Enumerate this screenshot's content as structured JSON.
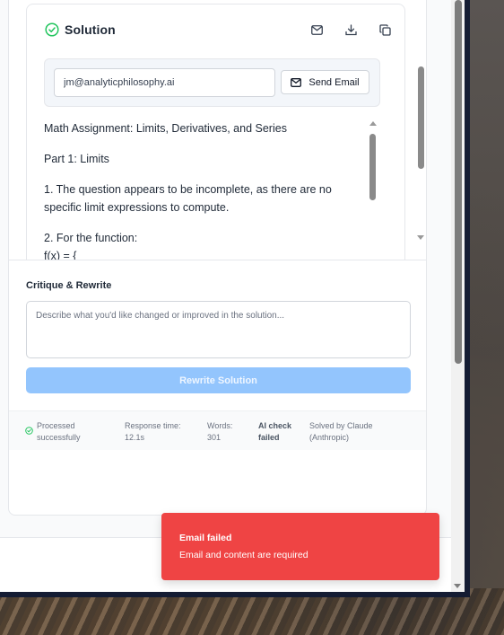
{
  "solution": {
    "title": "Solution",
    "actions": [
      "email-icon",
      "download-icon",
      "copy-icon"
    ],
    "email": {
      "value": "jm@analyticphilosophy.ai",
      "send_label": "Send Email"
    },
    "content": [
      "Math Assignment: Limits, Derivatives, and Series",
      "Part 1: Limits",
      "1. The question appears to be incomplete, as there are no specific limit expressions to compute.",
      "2. For the function:",
      "f(x) = {"
    ]
  },
  "critique": {
    "label": "Critique & Rewrite",
    "placeholder": "Describe what you'd like changed or improved in the solution...",
    "button_label": "Rewrite Solution"
  },
  "status": {
    "processed": "Processed successfully",
    "response_label": "Response time:",
    "response_value": "12.1s",
    "words_label": "Words:",
    "words_value": "301",
    "ai_check_label": "AI check",
    "ai_check_value": "failed",
    "solved_label": "Solved by Claude",
    "solved_value": "(Anthropic)"
  },
  "toast": {
    "title": "Email failed",
    "message": "Email and content are required"
  },
  "colors": {
    "accent_green": "#22c55e",
    "toast_red": "#ef4444",
    "button_disabled_blue": "#93c5fd"
  }
}
